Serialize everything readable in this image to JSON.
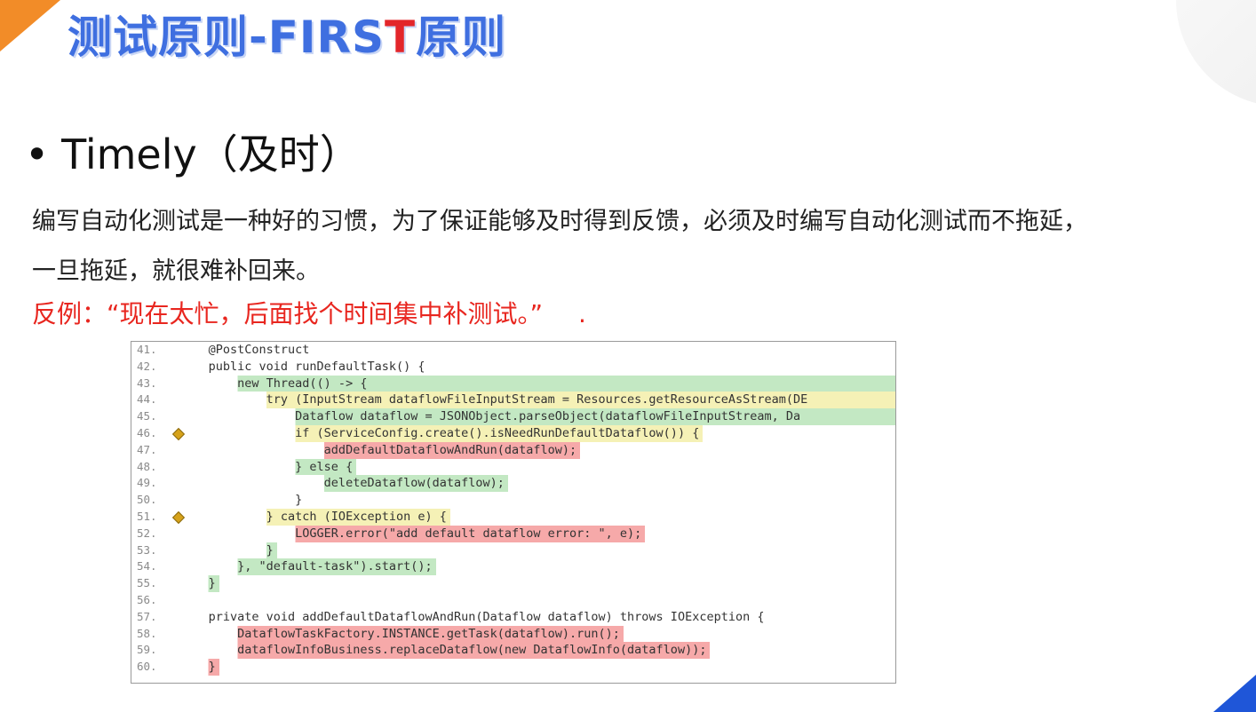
{
  "title": {
    "main": "测试原则-FIRS",
    "accent": "T",
    "suffix": "原则"
  },
  "bullet": {
    "symbol": "•",
    "text": "Timely（及时）"
  },
  "paragraph": {
    "line1": "编写自动化测试是一种好的习惯，为了保证能够及时得到反馈，必须及时编写自动化测试而不拖延，",
    "line2": "一旦拖延，就很难补回来。"
  },
  "counter_example": {
    "label": "反例：",
    "quote": "“现在太忙，后面找个时间集中补测试。”",
    "trailing": "."
  },
  "colors": {
    "title": "#3f6fe0",
    "title_accent": "#e3262a",
    "counter": "#e8261f",
    "coverage_full": "#c3e8c3",
    "coverage_partial": "#f5f1b6",
    "coverage_none": "#f6a9a9"
  },
  "code": {
    "lines": [
      {
        "n": "41.",
        "indent": 5,
        "text": "@PostConstruct",
        "cov": "none",
        "marker": false
      },
      {
        "n": "42.",
        "indent": 5,
        "text": "public void runDefaultTask() {",
        "cov": "none",
        "marker": false
      },
      {
        "n": "43.",
        "indent": 9,
        "text": "new Thread(() -> {",
        "cov": "green",
        "marker": false,
        "fill": true
      },
      {
        "n": "44.",
        "indent": 13,
        "text": "try (InputStream dataflowFileInputStream = Resources.getResourceAsStream(DE",
        "cov": "yellow",
        "marker": false,
        "fill": true
      },
      {
        "n": "45.",
        "indent": 17,
        "text": "Dataflow dataflow = JSONObject.parseObject(dataflowFileInputStream, Da",
        "cov": "green",
        "marker": false,
        "fill": true
      },
      {
        "n": "46.",
        "indent": 17,
        "text": "if (ServiceConfig.create().isNeedRunDefaultDataflow()) {",
        "cov": "yellow",
        "marker": true
      },
      {
        "n": "47.",
        "indent": 21,
        "text": "addDefaultDataflowAndRun(dataflow);",
        "cov": "red",
        "marker": false
      },
      {
        "n": "48.",
        "indent": 17,
        "text": "} else {",
        "cov": "green",
        "marker": false
      },
      {
        "n": "49.",
        "indent": 21,
        "text": "deleteDataflow(dataflow);",
        "cov": "green",
        "marker": false
      },
      {
        "n": "50.",
        "indent": 17,
        "text": "}",
        "cov": "none",
        "marker": false
      },
      {
        "n": "51.",
        "indent": 13,
        "text": "} catch (IOException e) {",
        "cov": "yellow",
        "marker": true
      },
      {
        "n": "52.",
        "indent": 17,
        "text": "LOGGER.error(\"add default dataflow error: \", e);",
        "cov": "red",
        "marker": false
      },
      {
        "n": "53.",
        "indent": 13,
        "text": "}",
        "cov": "green",
        "marker": false
      },
      {
        "n": "54.",
        "indent": 9,
        "text": "}, \"default-task\").start();",
        "cov": "green",
        "marker": false
      },
      {
        "n": "55.",
        "indent": 5,
        "text": "}",
        "cov": "green",
        "marker": false
      },
      {
        "n": "56.",
        "indent": 0,
        "text": "",
        "cov": "none",
        "marker": false
      },
      {
        "n": "57.",
        "indent": 5,
        "text": "private void addDefaultDataflowAndRun(Dataflow dataflow) throws IOException {",
        "cov": "none",
        "marker": false
      },
      {
        "n": "58.",
        "indent": 9,
        "text": "DataflowTaskFactory.INSTANCE.getTask(dataflow).run();",
        "cov": "red",
        "marker": false
      },
      {
        "n": "59.",
        "indent": 9,
        "text": "dataflowInfoBusiness.replaceDataflow(new DataflowInfo(dataflow));",
        "cov": "red",
        "marker": false
      },
      {
        "n": "60.",
        "indent": 5,
        "text": "}",
        "cov": "red",
        "marker": false
      }
    ]
  }
}
